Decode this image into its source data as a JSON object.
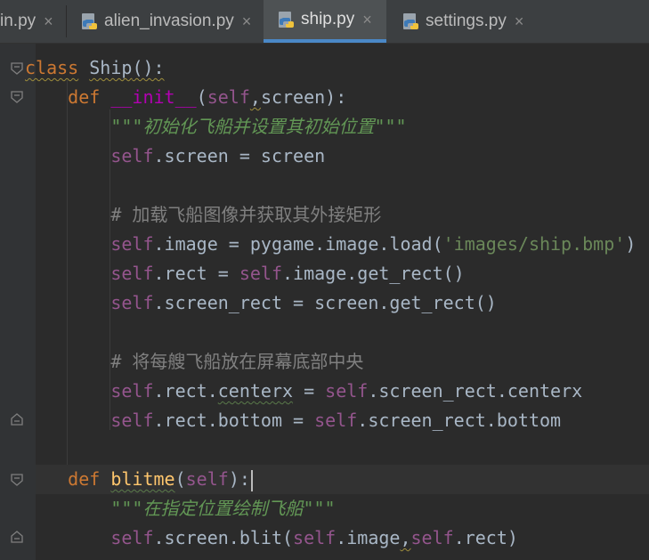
{
  "tabs": [
    {
      "label": "in.py",
      "close": "×",
      "icon": "python-file-icon",
      "active": false
    },
    {
      "label": "alien_invasion.py",
      "close": "×",
      "icon": "python-file-icon",
      "active": false
    },
    {
      "label": "ship.py",
      "close": "×",
      "icon": "python-file-icon",
      "active": true
    },
    {
      "label": "settings.py",
      "close": "×",
      "icon": "python-file-icon",
      "active": false
    }
  ],
  "code": {
    "l1": {
      "kw": "class",
      "name": "Ship",
      "rest": "():"
    },
    "l2": {
      "kw": "def",
      "name": "__init__",
      "p1": "(",
      "self": "self",
      "comma": ",",
      "rest": "screen):"
    },
    "l3": {
      "doc": "\"\"\"初始化飞船并设置其初始位置\"\"\""
    },
    "l4": {
      "self": "self",
      "rest": ".screen = screen"
    },
    "l6": {
      "comment": "# 加载飞船图像并获取其外接矩形"
    },
    "l7": {
      "self": "self",
      "rest": ".image = pygame.image.load(",
      "str": "'images/ship.bmp'",
      "end": ")"
    },
    "l8": {
      "self1": "self",
      "mid": ".rect = ",
      "self2": "self",
      "rest": ".image.get_rect()"
    },
    "l9": {
      "self": "self",
      "rest": ".screen_rect = screen.get_rect()"
    },
    "l11": {
      "comment": "# 将每艘飞船放在屏幕底部中央"
    },
    "l12": {
      "self1": "self",
      "mid1": ".rect.",
      "attr": "centerx",
      "mid2": " = ",
      "self2": "self",
      "rest": ".screen_rect.centerx"
    },
    "l13": {
      "self1": "self",
      "mid": ".rect.bottom = ",
      "self2": "self",
      "rest": ".screen_rect.bottom"
    },
    "l15": {
      "kw": "def",
      "name": "blitme",
      "p1": "(",
      "self": "self",
      "rest": "):"
    },
    "l16": {
      "doc": "\"\"\"在指定位置绘制飞船\"\"\""
    },
    "l17": {
      "self1": "self",
      "mid": ".screen.blit(",
      "self2": "self",
      "mid2": ".image",
      "comma": ",",
      "self3": "self",
      "rest": ".rect)"
    }
  },
  "colors": {
    "background": "#2b2b2b",
    "keyword": "#cc7832",
    "self": "#94558d",
    "function": "#ffc66d",
    "string": "#6a8759",
    "comment": "#808080",
    "accent": "#4a88c7"
  }
}
